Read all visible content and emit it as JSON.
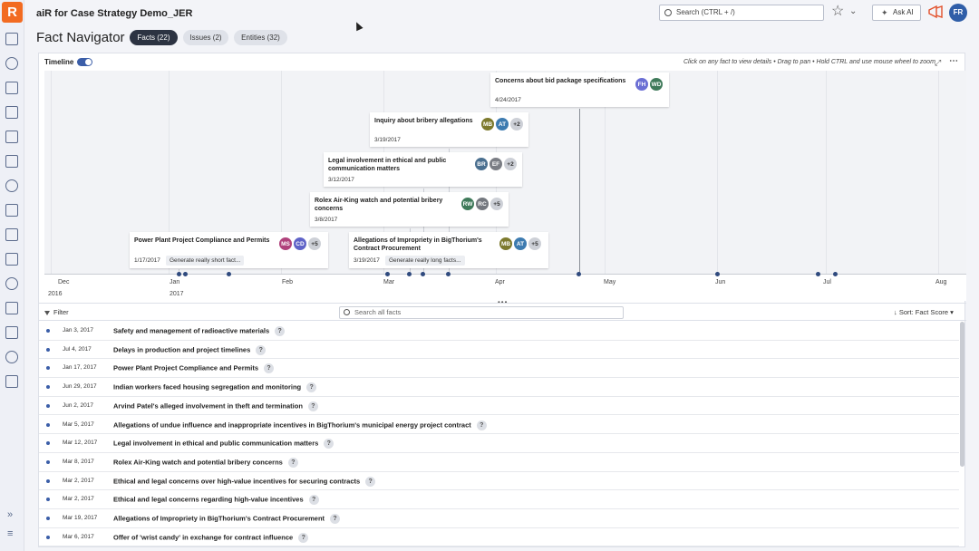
{
  "app": {
    "logo_letter": "R",
    "title": "aiR for Case Strategy Demo_JER",
    "page_title": "Fact Navigator"
  },
  "header": {
    "search_placeholder": "Search (CTRL + /)",
    "ask_ai_label": "Ask AI",
    "user_initials": "FR"
  },
  "tabs": [
    {
      "label": "Facts (22)",
      "active": true
    },
    {
      "label": "Issues (2)",
      "active": false
    },
    {
      "label": "Entities (32)",
      "active": false
    }
  ],
  "timeline": {
    "label": "Timeline",
    "enabled": true,
    "hint": "Click on any fact to view details • Drag to pan • Hold CTRL and use mouse wheel to zoom",
    "months": [
      "Dec",
      "Jan",
      "Feb",
      "Mar",
      "Apr",
      "May",
      "Jun",
      "Jul",
      "Aug"
    ],
    "years": [
      "2016",
      "2017"
    ],
    "cards": [
      {
        "title": "Concerns about bid package specifications",
        "date": "4/24/2017",
        "avatars": [
          {
            "initials": "FH",
            "color": "#6b6fd4"
          },
          {
            "initials": "WD",
            "color": "#3f7a5a"
          }
        ],
        "more": ""
      },
      {
        "title": "Inquiry about bribery allegations",
        "date": "3/19/2017",
        "avatars": [
          {
            "initials": "MB",
            "color": "#7d7a2e"
          },
          {
            "initials": "AT",
            "color": "#3d7bb0"
          }
        ],
        "more": "+2"
      },
      {
        "title": "Legal involvement in ethical and public communication matters",
        "date": "3/12/2017",
        "avatars": [
          {
            "initials": "BR",
            "color": "#4a6f8f"
          },
          {
            "initials": "EF",
            "color": "#7a7d84"
          }
        ],
        "more": "+2"
      },
      {
        "title": "Rolex Air-King watch and potential bribery concerns",
        "date": "3/8/2017",
        "avatars": [
          {
            "initials": "RW",
            "color": "#3f7a5a"
          },
          {
            "initials": "RC",
            "color": "#74787f"
          }
        ],
        "more": "+5"
      },
      {
        "title": "Power Plant Project Compliance and Permits",
        "date": "1/17/2017",
        "chip": "Generate really short fact...",
        "avatars": [
          {
            "initials": "MS",
            "color": "#b0427c"
          },
          {
            "initials": "CD",
            "color": "#5f63c8"
          }
        ],
        "more": "+5"
      },
      {
        "title": "Allegations of Impropriety in BigThorium's Contract Procurement",
        "date": "3/19/2017",
        "chip": "Generate really long facts...",
        "avatars": [
          {
            "initials": "MB",
            "color": "#7d7a2e"
          },
          {
            "initials": "AT",
            "color": "#3d7bb0"
          }
        ],
        "more": "+5"
      }
    ]
  },
  "facts": {
    "filter_label": "Filter",
    "search_placeholder": "Search all facts",
    "sort_label": "Sort: Fact Score",
    "rows": [
      {
        "date": "Jan 3, 2017",
        "title": "Safety and management of radioactive materials"
      },
      {
        "date": "Jul 4, 2017",
        "title": "Delays in production and project timelines"
      },
      {
        "date": "Jan 17, 2017",
        "title": "Power Plant Project Compliance and Permits"
      },
      {
        "date": "Jun 29, 2017",
        "title": "Indian workers faced housing segregation and monitoring"
      },
      {
        "date": "Jun 2, 2017",
        "title": "Arvind Patel's alleged involvement in theft and termination"
      },
      {
        "date": "Mar 5, 2017",
        "title": "Allegations of undue influence and inappropriate incentives in BigThorium's municipal energy project contract"
      },
      {
        "date": "Mar 12, 2017",
        "title": "Legal involvement in ethical and public communication matters"
      },
      {
        "date": "Mar 8, 2017",
        "title": "Rolex Air-King watch and potential bribery concerns"
      },
      {
        "date": "Mar 2, 2017",
        "title": "Ethical and legal concerns over high-value incentives for securing contracts"
      },
      {
        "date": "Mar 2, 2017",
        "title": "Ethical and legal concerns regarding high-value incentives"
      },
      {
        "date": "Mar 19, 2017",
        "title": "Allegations of Impropriety in BigThorium's Contract Procurement"
      },
      {
        "date": "Mar 6, 2017",
        "title": "Offer of 'wrist candy' in exchange for contract influence"
      }
    ]
  }
}
